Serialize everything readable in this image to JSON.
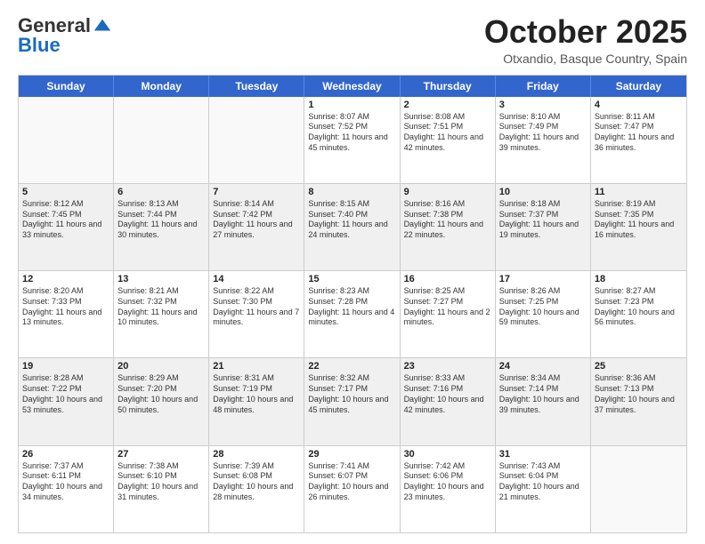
{
  "logo": {
    "general": "General",
    "blue": "Blue"
  },
  "header": {
    "month": "October 2025",
    "location": "Otxandio, Basque Country, Spain"
  },
  "days": [
    "Sunday",
    "Monday",
    "Tuesday",
    "Wednesday",
    "Thursday",
    "Friday",
    "Saturday"
  ],
  "weeks": [
    [
      {
        "day": "",
        "text": ""
      },
      {
        "day": "",
        "text": ""
      },
      {
        "day": "",
        "text": ""
      },
      {
        "day": "1",
        "text": "Sunrise: 8:07 AM\nSunset: 7:52 PM\nDaylight: 11 hours and 45 minutes."
      },
      {
        "day": "2",
        "text": "Sunrise: 8:08 AM\nSunset: 7:51 PM\nDaylight: 11 hours and 42 minutes."
      },
      {
        "day": "3",
        "text": "Sunrise: 8:10 AM\nSunset: 7:49 PM\nDaylight: 11 hours and 39 minutes."
      },
      {
        "day": "4",
        "text": "Sunrise: 8:11 AM\nSunset: 7:47 PM\nDaylight: 11 hours and 36 minutes."
      }
    ],
    [
      {
        "day": "5",
        "text": "Sunrise: 8:12 AM\nSunset: 7:45 PM\nDaylight: 11 hours and 33 minutes."
      },
      {
        "day": "6",
        "text": "Sunrise: 8:13 AM\nSunset: 7:44 PM\nDaylight: 11 hours and 30 minutes."
      },
      {
        "day": "7",
        "text": "Sunrise: 8:14 AM\nSunset: 7:42 PM\nDaylight: 11 hours and 27 minutes."
      },
      {
        "day": "8",
        "text": "Sunrise: 8:15 AM\nSunset: 7:40 PM\nDaylight: 11 hours and 24 minutes."
      },
      {
        "day": "9",
        "text": "Sunrise: 8:16 AM\nSunset: 7:38 PM\nDaylight: 11 hours and 22 minutes."
      },
      {
        "day": "10",
        "text": "Sunrise: 8:18 AM\nSunset: 7:37 PM\nDaylight: 11 hours and 19 minutes."
      },
      {
        "day": "11",
        "text": "Sunrise: 8:19 AM\nSunset: 7:35 PM\nDaylight: 11 hours and 16 minutes."
      }
    ],
    [
      {
        "day": "12",
        "text": "Sunrise: 8:20 AM\nSunset: 7:33 PM\nDaylight: 11 hours and 13 minutes."
      },
      {
        "day": "13",
        "text": "Sunrise: 8:21 AM\nSunset: 7:32 PM\nDaylight: 11 hours and 10 minutes."
      },
      {
        "day": "14",
        "text": "Sunrise: 8:22 AM\nSunset: 7:30 PM\nDaylight: 11 hours and 7 minutes."
      },
      {
        "day": "15",
        "text": "Sunrise: 8:23 AM\nSunset: 7:28 PM\nDaylight: 11 hours and 4 minutes."
      },
      {
        "day": "16",
        "text": "Sunrise: 8:25 AM\nSunset: 7:27 PM\nDaylight: 11 hours and 2 minutes."
      },
      {
        "day": "17",
        "text": "Sunrise: 8:26 AM\nSunset: 7:25 PM\nDaylight: 10 hours and 59 minutes."
      },
      {
        "day": "18",
        "text": "Sunrise: 8:27 AM\nSunset: 7:23 PM\nDaylight: 10 hours and 56 minutes."
      }
    ],
    [
      {
        "day": "19",
        "text": "Sunrise: 8:28 AM\nSunset: 7:22 PM\nDaylight: 10 hours and 53 minutes."
      },
      {
        "day": "20",
        "text": "Sunrise: 8:29 AM\nSunset: 7:20 PM\nDaylight: 10 hours and 50 minutes."
      },
      {
        "day": "21",
        "text": "Sunrise: 8:31 AM\nSunset: 7:19 PM\nDaylight: 10 hours and 48 minutes."
      },
      {
        "day": "22",
        "text": "Sunrise: 8:32 AM\nSunset: 7:17 PM\nDaylight: 10 hours and 45 minutes."
      },
      {
        "day": "23",
        "text": "Sunrise: 8:33 AM\nSunset: 7:16 PM\nDaylight: 10 hours and 42 minutes."
      },
      {
        "day": "24",
        "text": "Sunrise: 8:34 AM\nSunset: 7:14 PM\nDaylight: 10 hours and 39 minutes."
      },
      {
        "day": "25",
        "text": "Sunrise: 8:36 AM\nSunset: 7:13 PM\nDaylight: 10 hours and 37 minutes."
      }
    ],
    [
      {
        "day": "26",
        "text": "Sunrise: 7:37 AM\nSunset: 6:11 PM\nDaylight: 10 hours and 34 minutes."
      },
      {
        "day": "27",
        "text": "Sunrise: 7:38 AM\nSunset: 6:10 PM\nDaylight: 10 hours and 31 minutes."
      },
      {
        "day": "28",
        "text": "Sunrise: 7:39 AM\nSunset: 6:08 PM\nDaylight: 10 hours and 28 minutes."
      },
      {
        "day": "29",
        "text": "Sunrise: 7:41 AM\nSunset: 6:07 PM\nDaylight: 10 hours and 26 minutes."
      },
      {
        "day": "30",
        "text": "Sunrise: 7:42 AM\nSunset: 6:06 PM\nDaylight: 10 hours and 23 minutes."
      },
      {
        "day": "31",
        "text": "Sunrise: 7:43 AM\nSunset: 6:04 PM\nDaylight: 10 hours and 21 minutes."
      },
      {
        "day": "",
        "text": ""
      }
    ]
  ]
}
